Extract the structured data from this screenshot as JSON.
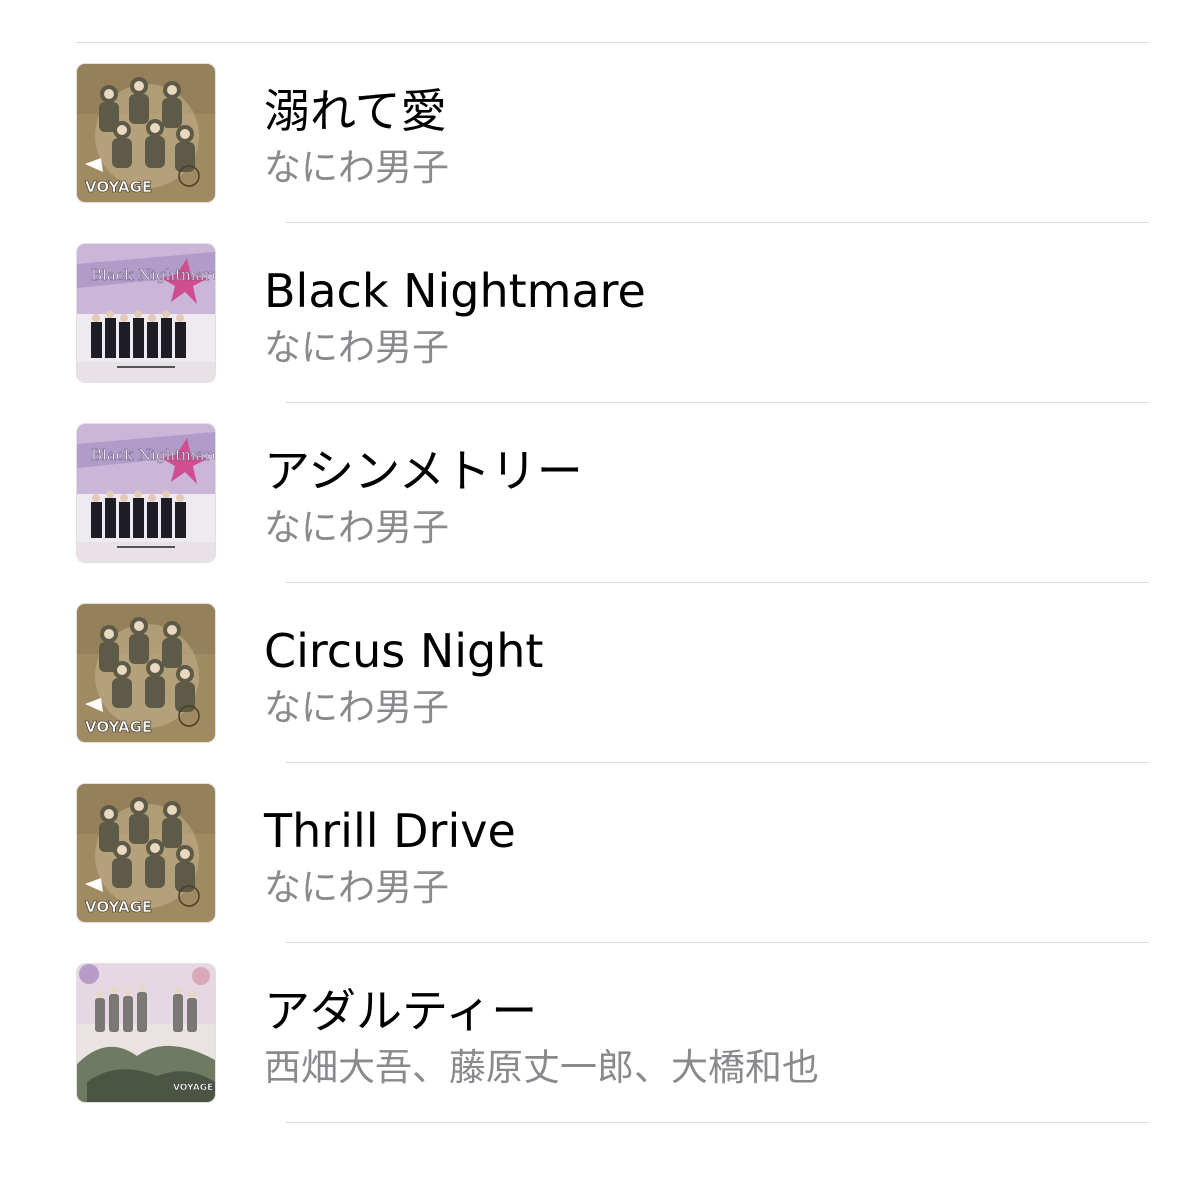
{
  "songs": [
    {
      "title": "溺れて愛",
      "artist": "なにわ男子",
      "artwork": "voyage-cover",
      "artwork_text": "VOYAGE"
    },
    {
      "title": "Black Nightmare",
      "artist": "なにわ男子",
      "artwork": "black-nightmare-cover",
      "artwork_text": "Black Nightmare"
    },
    {
      "title": "アシンメトリー",
      "artist": "なにわ男子",
      "artwork": "black-nightmare-cover",
      "artwork_text": "Black Nightmare"
    },
    {
      "title": "Circus Night",
      "artist": "なにわ男子",
      "artwork": "voyage-cover",
      "artwork_text": "VOYAGE"
    },
    {
      "title": "Thrill Drive",
      "artist": "なにわ男子",
      "artwork": "voyage-cover",
      "artwork_text": "VOYAGE"
    },
    {
      "title": "アダルティー",
      "artist": "西畑大吾、藤原丈一郎、大橋和也",
      "artwork": "adulty-cover",
      "artwork_text": "VOYAGE"
    }
  ],
  "colors": {
    "title": "#000000",
    "subtitle": "#8a8a8e",
    "divider": "#dcdcde",
    "voyage_bg": "#a08a62",
    "nightmare_bg": "#c9b6d8",
    "adulty_bg": "#e9e4e2"
  }
}
